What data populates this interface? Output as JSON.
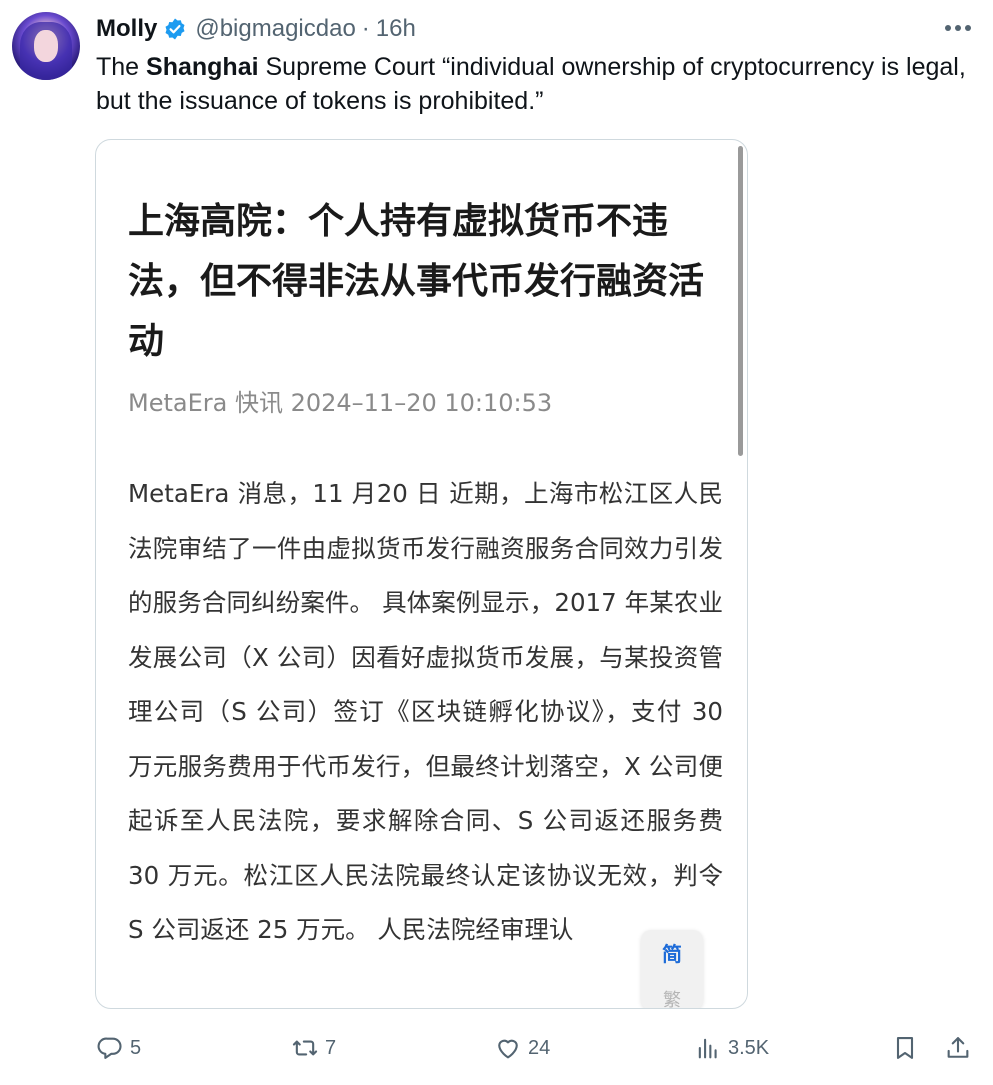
{
  "author": {
    "name": "Molly",
    "handle": "@bigmagicdao",
    "separator": "·",
    "time": "16h"
  },
  "tweet": {
    "text_before": "The ",
    "text_bold": "Shanghai",
    "text_after": " Supreme Court “individual ownership of cryptocurrency is legal, but the issuance of tokens is prohibited.”"
  },
  "media": {
    "title": "上海高院：个人持有虚拟货币不违法，但不得非法从事代币发行融资活动",
    "meta": "MetaEra 快讯  2024–11–20 10:10:53",
    "body": "MetaEra 消息，11 月20 日 近期，上海市松江区人民法院审结了一件由虚拟货币发行融资服务合同效力引发的服务合同纠纷案件。 具体案例显示，2017 年某农业发展公司（X 公司）因看好虚拟货币发展，与某投资管理公司（S 公司）签订《区块链孵化协议》，支付 30 万元服务费用于代币发行，但最终计划落空，X 公司便起诉至人民法院，要求解除合同、S 公司返还服务费 30 万元。松江区人民法院最终认定该协议无效，判令 S 公司返还 25 万元。 人民法院经审理认",
    "simplified_label": "简",
    "traditional_label": "繁"
  },
  "actions": {
    "replies": "5",
    "reposts": "7",
    "likes": "24",
    "views": "3.5K"
  },
  "icons": {
    "verified": "verified-badge-icon",
    "more": "more-horizontal-icon",
    "reply": "reply-icon",
    "repost": "repost-icon",
    "like": "heart-icon",
    "views": "views-bar-chart-icon",
    "bookmark": "bookmark-icon",
    "share": "share-icon"
  },
  "colors": {
    "verified_blue": "#1d9bf0",
    "secondary_text": "#536471"
  }
}
